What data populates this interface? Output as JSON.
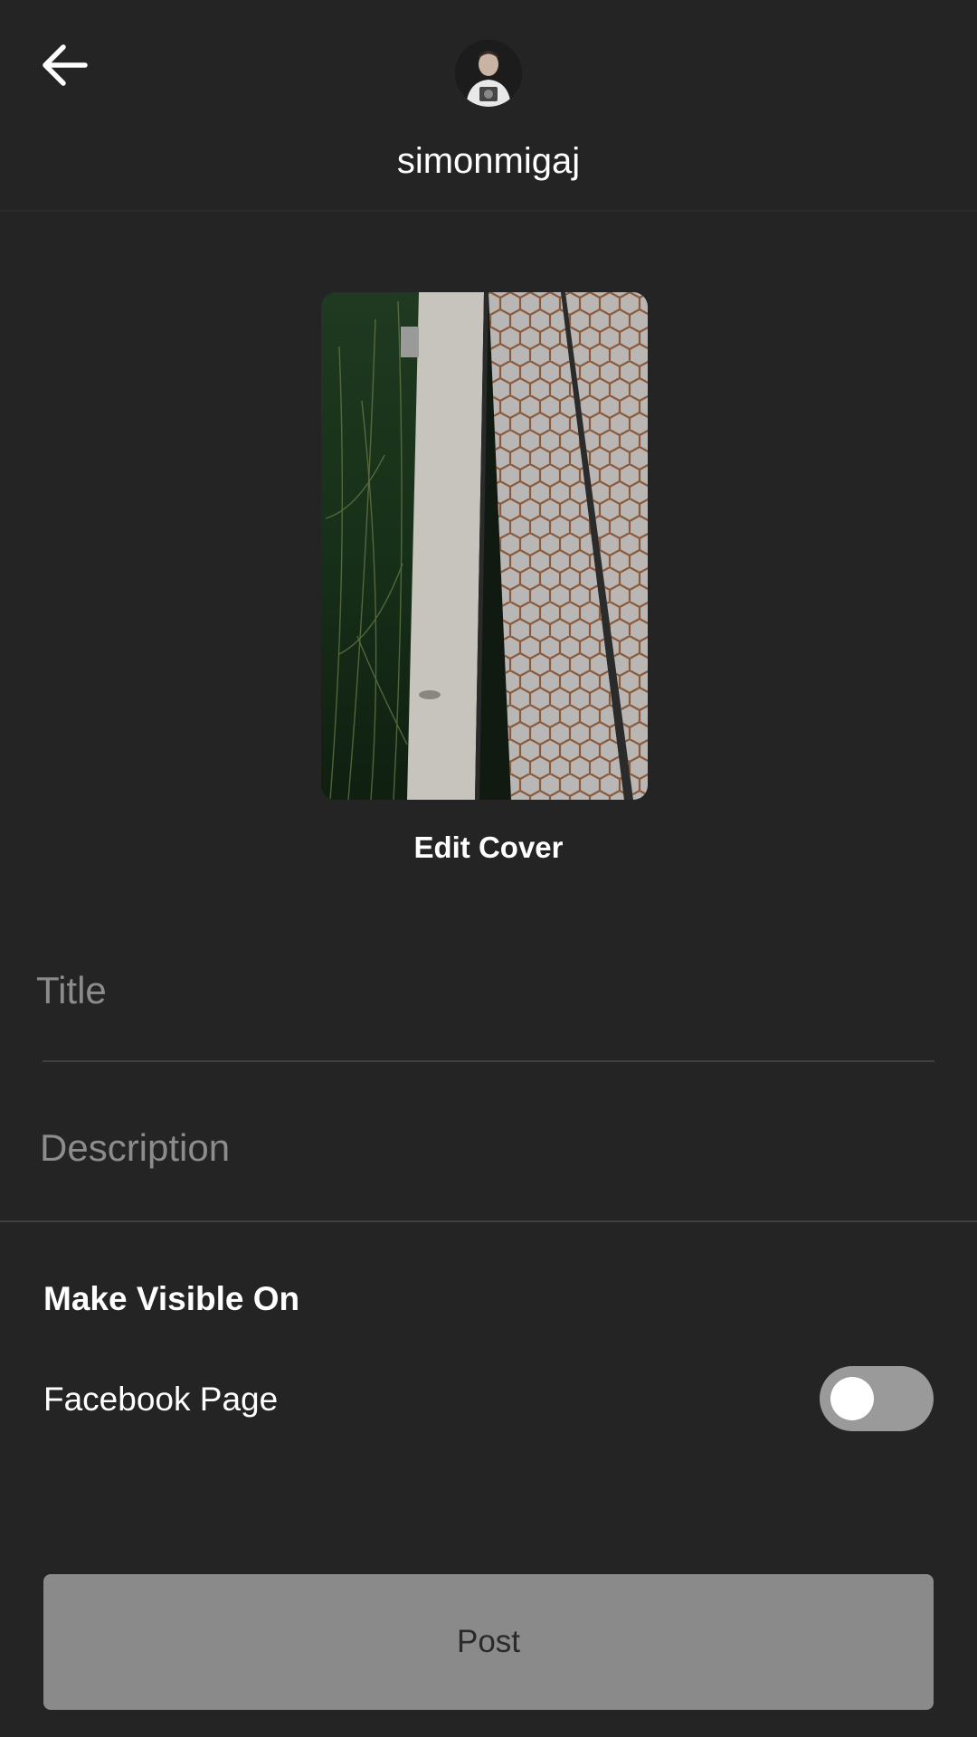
{
  "header": {
    "back_icon": "arrow-left-icon",
    "avatar_icon": "user-avatar",
    "username": "simonmigaj"
  },
  "cover": {
    "edit_label": "Edit Cover"
  },
  "form": {
    "title_placeholder": "Title",
    "title_value": "",
    "description_placeholder": "Description",
    "description_value": ""
  },
  "visibility": {
    "section_title": "Make Visible On",
    "items": [
      {
        "label": "Facebook Page",
        "enabled": false
      }
    ]
  },
  "actions": {
    "post_label": "Post"
  },
  "colors": {
    "background": "#242424",
    "toggle_track": "#9a9a9a",
    "post_button": "#8a8a8a",
    "placeholder": "#8c8c8c"
  }
}
